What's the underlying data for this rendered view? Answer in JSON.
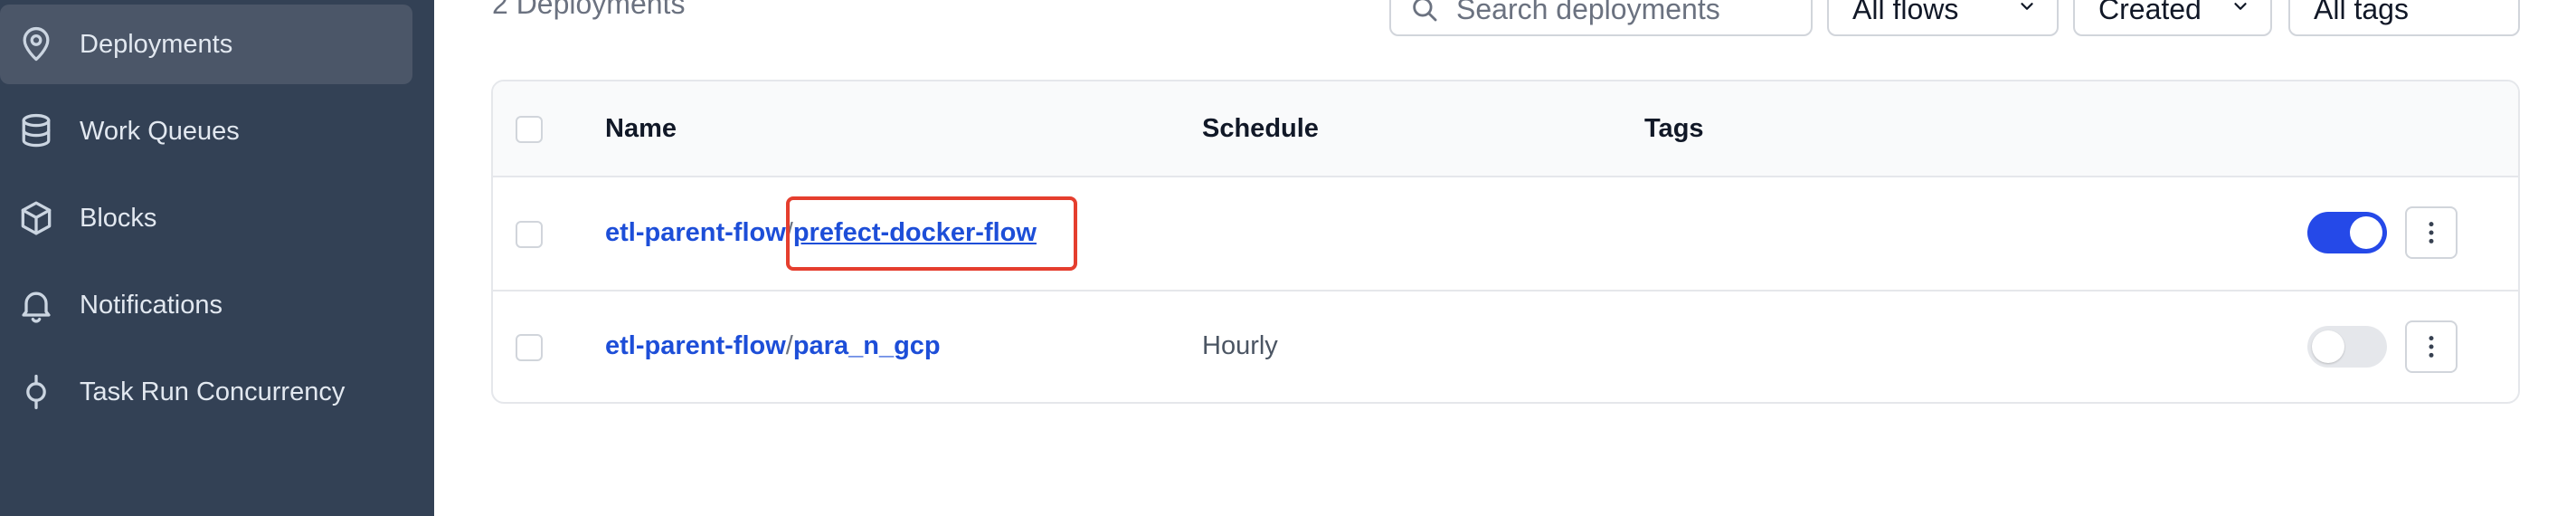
{
  "sidebar": {
    "items": [
      {
        "label": "Deployments",
        "icon": "location-pin-icon",
        "active": true
      },
      {
        "label": "Work Queues",
        "icon": "database-icon",
        "active": false
      },
      {
        "label": "Blocks",
        "icon": "cube-icon",
        "active": false
      },
      {
        "label": "Notifications",
        "icon": "bell-icon",
        "active": false
      },
      {
        "label": "Task Run Concurrency",
        "icon": "concurrency-icon",
        "active": false
      }
    ]
  },
  "toolbar": {
    "count_text": "2 Deployments",
    "search_placeholder": "Search deployments",
    "flows_filter": "All flows",
    "sort_select": "Created",
    "tags_filter": "All tags"
  },
  "table": {
    "headers": {
      "name": "Name",
      "schedule": "Schedule",
      "tags": "Tags"
    },
    "rows": [
      {
        "flow": "etl-parent-flow",
        "separator": "/",
        "deployment": "prefect-docker-flow",
        "schedule": "",
        "active": true
      },
      {
        "flow": "etl-parent-flow",
        "separator": "/",
        "deployment": "para_n_gcp",
        "schedule": "Hourly",
        "active": false
      }
    ]
  },
  "colors": {
    "sidebar_bg": "#334155",
    "link": "#1d4ed8",
    "toggle_on": "#2549e8",
    "highlight": "#e53e2e"
  }
}
